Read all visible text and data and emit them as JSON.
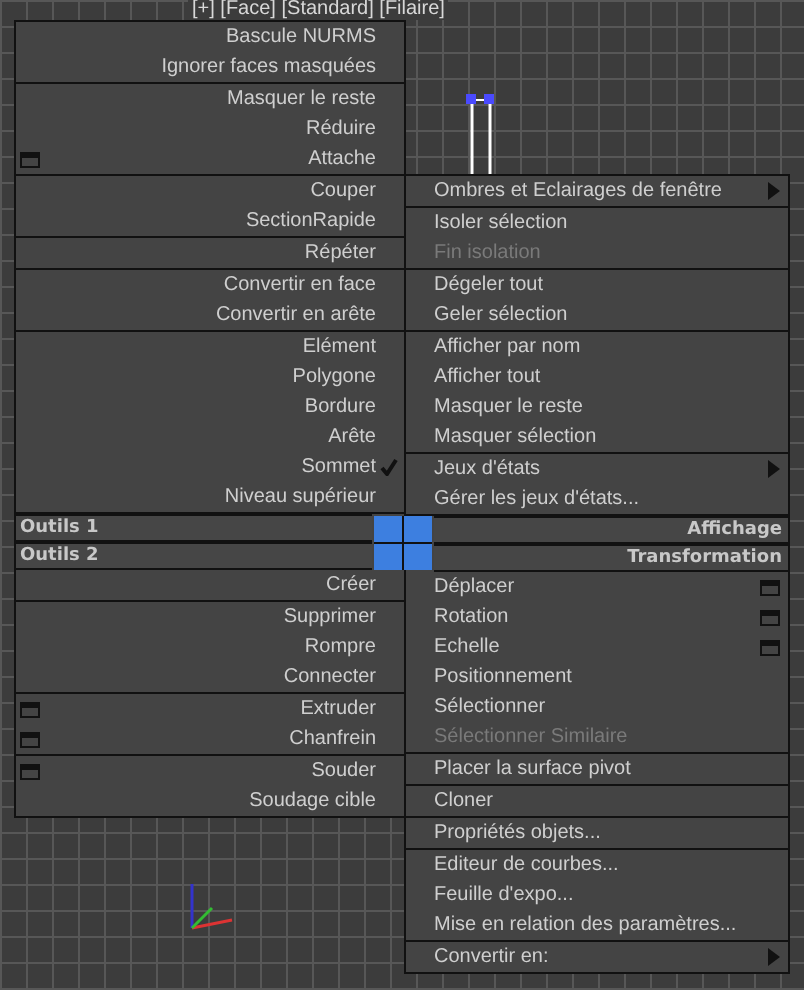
{
  "viewport": {
    "label": "[+] [Face] [Standard] [Filaire]"
  },
  "left": [
    {
      "title": "Outils 1",
      "sections": [
        [
          {
            "label": "Bascule NURMS",
            "kind": "plain"
          },
          {
            "label": "Ignorer faces masquées",
            "kind": "plain"
          }
        ],
        [
          {
            "label": "Masquer le reste",
            "kind": "plain"
          },
          {
            "label": "Réduire",
            "kind": "plain"
          },
          {
            "label": "Attache",
            "kind": "settings"
          }
        ],
        [
          {
            "label": "Couper",
            "kind": "plain"
          },
          {
            "label": "SectionRapide",
            "kind": "plain"
          }
        ],
        [
          {
            "label": "Répéter",
            "kind": "plain"
          }
        ],
        [
          {
            "label": "Convertir en face",
            "kind": "plain"
          },
          {
            "label": "Convertir en arête",
            "kind": "plain"
          }
        ],
        [
          {
            "label": "Elément",
            "kind": "plain"
          },
          {
            "label": "Polygone",
            "kind": "plain"
          },
          {
            "label": "Bordure",
            "kind": "plain"
          },
          {
            "label": "Arête",
            "kind": "plain"
          },
          {
            "label": "Sommet",
            "kind": "checked"
          },
          {
            "label": "Niveau supérieur",
            "kind": "plain"
          }
        ]
      ]
    },
    {
      "title": "Outils 2",
      "sections": [
        [
          {
            "label": "Créer",
            "kind": "plain"
          }
        ],
        [
          {
            "label": "Supprimer",
            "kind": "plain"
          },
          {
            "label": "Rompre",
            "kind": "plain"
          },
          {
            "label": "Connecter",
            "kind": "plain"
          }
        ],
        [
          {
            "label": "Extruder",
            "kind": "settings"
          },
          {
            "label": "Chanfrein",
            "kind": "settings"
          }
        ],
        [
          {
            "label": "Souder",
            "kind": "settings"
          },
          {
            "label": "Soudage cible",
            "kind": "plain"
          }
        ]
      ]
    }
  ],
  "right": [
    {
      "title": "Affichage",
      "sections": [
        [
          {
            "label": "Ombres et Eclairages de fenêtre",
            "kind": "submenu"
          }
        ],
        [
          {
            "label": "Isoler sélection",
            "kind": "plain"
          },
          {
            "label": "Fin isolation",
            "kind": "disabled"
          }
        ],
        [
          {
            "label": "Dégeler tout",
            "kind": "plain"
          },
          {
            "label": "Geler sélection",
            "kind": "plain"
          }
        ],
        [
          {
            "label": "Afficher par nom",
            "kind": "plain"
          },
          {
            "label": "Afficher tout",
            "kind": "plain"
          },
          {
            "label": "Masquer le reste",
            "kind": "plain"
          },
          {
            "label": "Masquer sélection",
            "kind": "plain"
          }
        ],
        [
          {
            "label": "Jeux d'états",
            "kind": "submenu"
          },
          {
            "label": "Gérer les jeux d'états...",
            "kind": "plain"
          }
        ]
      ]
    },
    {
      "title": "Transformation",
      "sections": [
        [
          {
            "label": "Déplacer",
            "kind": "settings"
          },
          {
            "label": "Rotation",
            "kind": "settings"
          },
          {
            "label": "Echelle",
            "kind": "settings"
          },
          {
            "label": "Positionnement",
            "kind": "plain"
          },
          {
            "label": "Sélectionner",
            "kind": "plain"
          },
          {
            "label": "Sélectionner Similaire",
            "kind": "disabled"
          }
        ],
        [
          {
            "label": "Placer la surface pivot",
            "kind": "plain"
          }
        ],
        [
          {
            "label": "Cloner",
            "kind": "plain"
          }
        ],
        [
          {
            "label": "Propriétés objets...",
            "kind": "plain"
          }
        ],
        [
          {
            "label": "Editeur de courbes...",
            "kind": "plain"
          },
          {
            "label": "Feuille d'expo...",
            "kind": "plain"
          },
          {
            "label": "Mise en relation des paramètres...",
            "kind": "plain"
          }
        ],
        [
          {
            "label": "Convertir en:",
            "kind": "submenu"
          }
        ]
      ]
    }
  ]
}
